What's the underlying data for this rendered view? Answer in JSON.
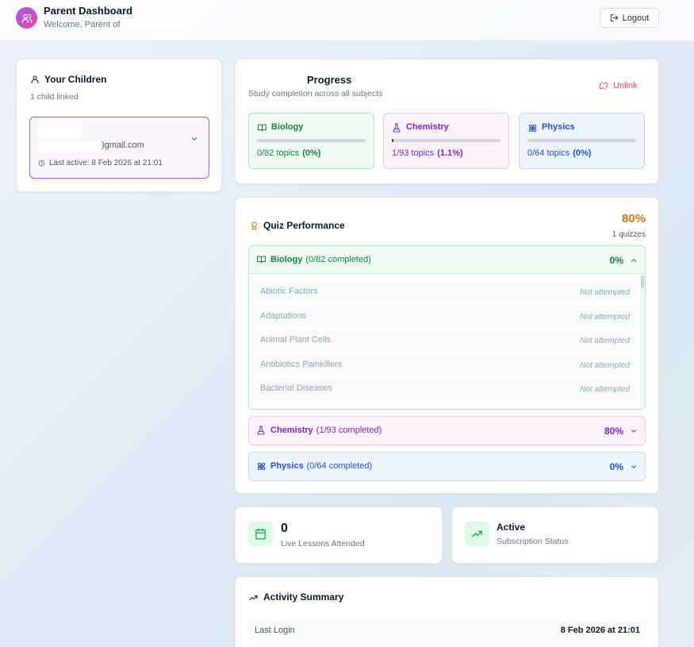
{
  "header": {
    "title": "Parent Dashboard",
    "welcome_prefix": "Welcome, Parent of",
    "logout_label": "Logout"
  },
  "children": {
    "title": "Your Children",
    "count_text": "1 child linked",
    "child": {
      "email_suffix": ")gmail.com",
      "last_active": "Last active: 8 Feb 2026 at 21:01"
    }
  },
  "progress": {
    "title": "Progress",
    "subtitle": "Study completion across all subjects",
    "unlink_label": "Unlink",
    "subjects": [
      {
        "name": "Biology",
        "topics": "0/82 topics",
        "pct": "(0%)",
        "fill": 0.0
      },
      {
        "name": "Chemistry",
        "topics": "1/93 topics",
        "pct": "(1.1%)",
        "fill": 0.011
      },
      {
        "name": "Physics",
        "topics": "0/64 topics",
        "pct": "(0%)",
        "fill": 0.0
      }
    ]
  },
  "quiz": {
    "title": "Quiz Performance",
    "score": "80%",
    "count_text": "1 quizzes",
    "sections": [
      {
        "name": "Biology",
        "completed": "(0/82 completed)",
        "pct": "0%"
      },
      {
        "name": "Chemistry",
        "completed": "(1/93 completed)",
        "pct": "80%"
      },
      {
        "name": "Physics",
        "completed": "(0/64 completed)",
        "pct": "0%"
      }
    ],
    "topics": [
      {
        "name": "Abiotic Factors",
        "status": "Not attempted"
      },
      {
        "name": "Adaptations",
        "status": "Not attempted"
      },
      {
        "name": "Animal Plant Cells",
        "status": "Not attempted"
      },
      {
        "name": "Antibiotics Painkillers",
        "status": "Not attempted"
      },
      {
        "name": "Bacterial Diseases",
        "status": "Not attempted"
      }
    ]
  },
  "stats": {
    "lessons_value": "0",
    "lessons_label": "Live Lessons Attended",
    "subscription_value": "Active",
    "subscription_label": "Subscription Status"
  },
  "activity": {
    "title": "Activity Summary",
    "last_login_label": "Last Login",
    "last_login_value": "8 Feb 2026 at 21:01"
  },
  "colors": {
    "biology": "#15803d",
    "chemistry": "#7e22ce",
    "physics": "#1d4ed8",
    "accent_orange": "#d97706",
    "unlink_red": "#ef4444"
  }
}
